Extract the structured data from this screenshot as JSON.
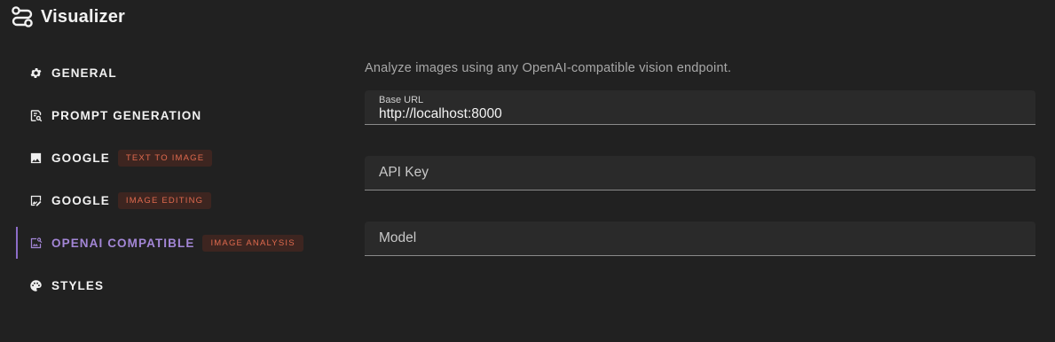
{
  "app": {
    "title": "Visualizer",
    "logo_icon": "route-icon"
  },
  "sidebar": {
    "items": [
      {
        "label": "GENERAL",
        "icon": "gear-icon",
        "active": false
      },
      {
        "label": "PROMPT GENERATION",
        "icon": "document-search-icon",
        "active": false
      },
      {
        "label": "GOOGLE",
        "icon": "image-icon",
        "badge": "TEXT TO IMAGE",
        "active": false
      },
      {
        "label": "GOOGLE",
        "icon": "image-edit-icon",
        "badge": "IMAGE EDITING",
        "active": false
      },
      {
        "label": "OPENAI COMPATIBLE",
        "icon": "image-search-icon",
        "badge": "IMAGE ANALYSIS",
        "active": true
      },
      {
        "label": "STYLES",
        "icon": "palette-icon",
        "active": false
      }
    ]
  },
  "main": {
    "description": "Analyze images using any OpenAI-compatible vision endpoint.",
    "fields": {
      "base_url": {
        "label": "Base URL",
        "value": "http://localhost:8000"
      },
      "api_key": {
        "label": "API Key",
        "value": ""
      },
      "model": {
        "label": "Model",
        "value": ""
      }
    }
  },
  "colors": {
    "background": "#212121",
    "field_background": "#2a2a2a",
    "accent": "#a386d6",
    "badge_text": "#e06a4e",
    "badge_background": "#3d2520"
  }
}
